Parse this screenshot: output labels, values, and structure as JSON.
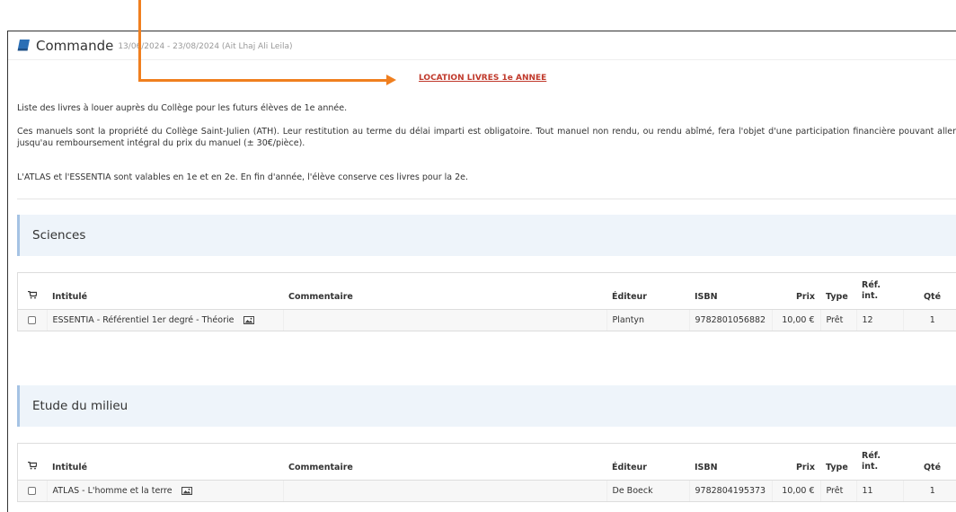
{
  "header": {
    "title": "Commande",
    "dates": "13/06/2024 - 23/08/2024 (Ait Lhaj Ali Leila)"
  },
  "heading_link": "LOCATION LIVRES 1e ANNEE",
  "paragraphs": {
    "p1": "Liste des livres à louer auprès du Collège pour les futurs élèves de 1e année.",
    "p2": "Ces manuels sont la propriété du Collège Saint-Julien (ATH).  Leur restitution au terme du délai imparti est obligatoire.  Tout manuel non rendu, ou rendu abîmé, fera l'objet d'une participation financière pouvant aller jusqu'au remboursement intégral du prix du manuel (± 30€/pièce).",
    "p3": "L'ATLAS et l'ESSENTIA sont valables en 1e et en 2e. En fin d'année, l'élève conserve ces livres pour la 2e."
  },
  "columns": {
    "title": "Intitulé",
    "comment": "Commentaire",
    "publisher": "Éditeur",
    "isbn": "ISBN",
    "price": "Prix",
    "type": "Type",
    "ref_line1": "Réf.",
    "ref_line2": "int.",
    "qty": "Qté"
  },
  "sections": [
    {
      "name": "Sciences",
      "row": {
        "title": "ESSENTIA - Référentiel 1er degré - Théorie",
        "comment": "",
        "publisher": "Plantyn",
        "isbn": "9782801056882",
        "price": "10,00 €",
        "type": "Prêt",
        "ref": "12",
        "qty": "1"
      }
    },
    {
      "name": "Etude du milieu",
      "row": {
        "title": "ATLAS - L'homme et la terre",
        "comment": "",
        "publisher": "De Boeck",
        "isbn": "9782804195373",
        "price": "10,00 €",
        "type": "Prêt",
        "ref": "11",
        "qty": "1"
      }
    }
  ],
  "colors": {
    "accent_orange": "#f07f1f",
    "link_red": "#c0392b",
    "section_bg": "#eef4fa",
    "section_border": "#a5c3e4",
    "book_icon": "#2b6fb5"
  }
}
